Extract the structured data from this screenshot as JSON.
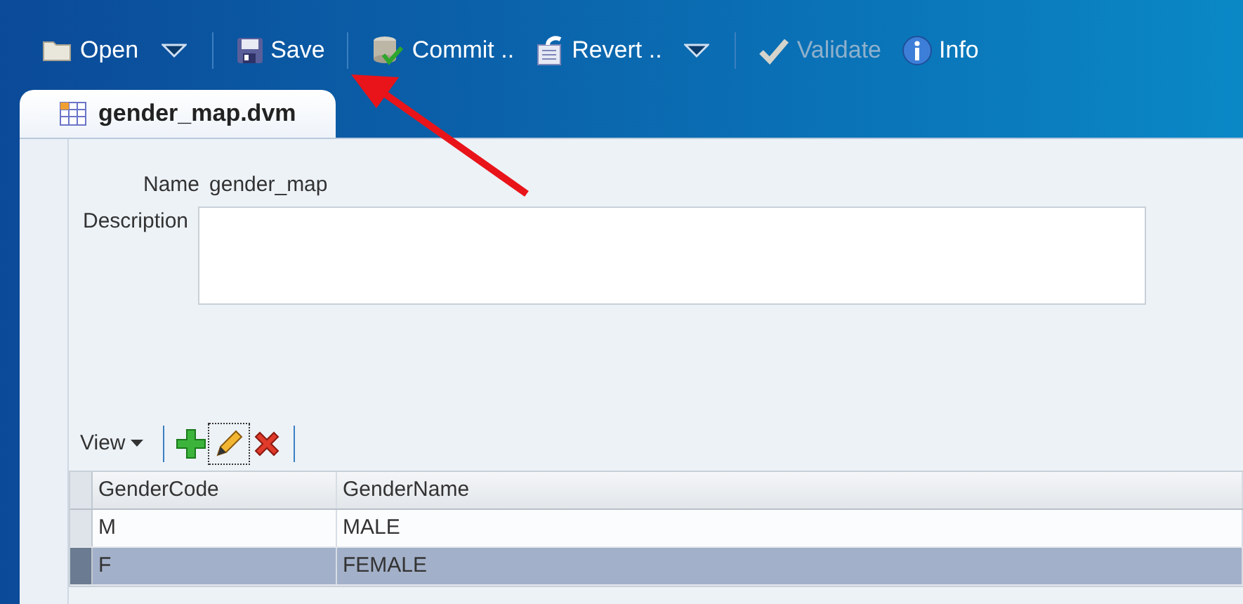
{
  "toolbar": [
    {
      "kind": "button",
      "label": "Open",
      "disabled": false,
      "menu": true
    },
    {
      "kind": "button",
      "label": "Save",
      "disabled": false,
      "menu": false
    },
    {
      "kind": "button",
      "label": "Commit ..",
      "disabled": false,
      "menu": false
    },
    {
      "kind": "button",
      "label": "Revert ..",
      "disabled": false,
      "menu": true
    },
    {
      "kind": "button",
      "label": "Validate",
      "disabled": true,
      "menu": false
    },
    {
      "kind": "button",
      "label": "Info",
      "disabled": false,
      "menu": false
    }
  ],
  "tab": {
    "label": "gender_map.dvm"
  },
  "form": {
    "name_label": "Name",
    "name_value": "gender_map",
    "description_label": "Description"
  },
  "table_toolbar": {
    "view_label": "View"
  },
  "table": {
    "columns": [
      "GenderCode",
      "GenderName"
    ],
    "rows": [
      {
        "cells": [
          "M",
          "MALE"
        ],
        "selected": false
      },
      {
        "cells": [
          "F",
          "FEMALE"
        ],
        "selected": true
      }
    ]
  }
}
